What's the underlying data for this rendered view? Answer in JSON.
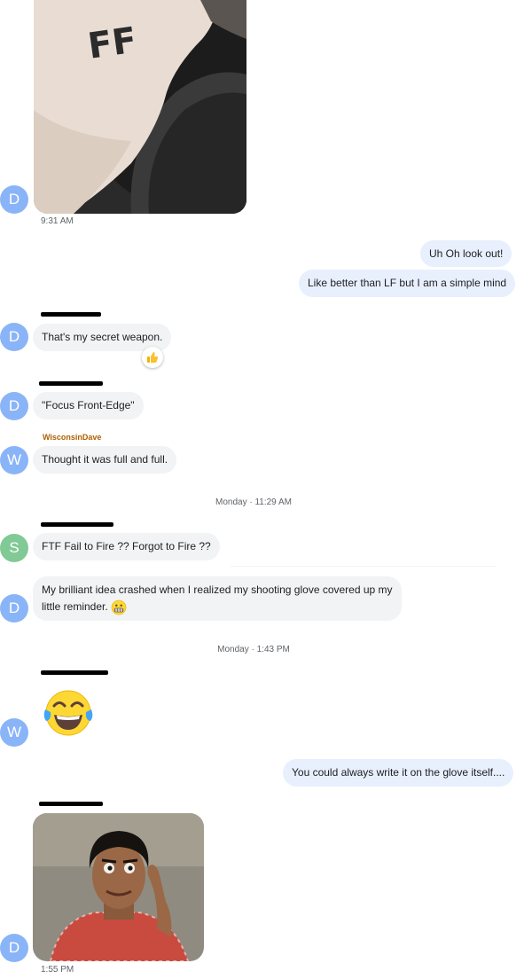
{
  "messages": {
    "m1_time": "9:31 AM",
    "m2_text": "Uh Oh look out!",
    "m3_text": "Like better than LF but I am a simple mind",
    "m4_text": "That's my secret weapon.",
    "m5_text": "\"Focus Front-Edge\"",
    "m6_sender": "WisconsinDave",
    "m6_text": "Thought it was full and full.",
    "divider1": "Monday · 11:29 AM",
    "m7_text": "FTF Fail to Fire ?? Forgot to Fire ??",
    "m8_text": "My brilliant idea crashed when I realized my shooting glove covered up my little reminder.",
    "divider2": "Monday · 1:43 PM",
    "m10_text": "You could always write it on the glove itself....",
    "m11_time": "1:55 PM"
  },
  "photo1": {
    "hand_text": "FF"
  },
  "avatars": {
    "d": "D",
    "w": "W",
    "s": "S"
  },
  "colors": {
    "avatar_blue": "#8ab4f8",
    "avatar_green": "#81c995",
    "incoming": "#f1f3f4",
    "outgoing": "#e8f0fe",
    "sender_name": "#b06000"
  },
  "icons": {
    "reaction": "thumbs-up-icon",
    "grimace": "grimacing-face-icon",
    "laugh": "tears-of-joy-icon"
  }
}
